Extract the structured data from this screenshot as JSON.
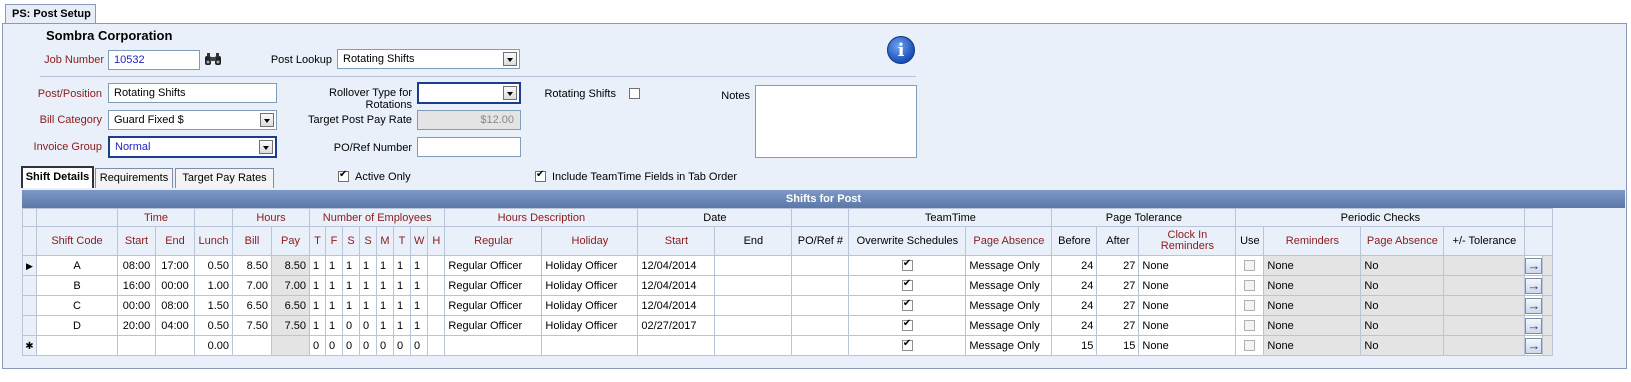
{
  "window": {
    "tab_title": "PS: Post Setup"
  },
  "header": {
    "company": "Sombra Corporation"
  },
  "form": {
    "job_number_label": "Job Number",
    "job_number": "10532",
    "post_lookup_label": "Post Lookup",
    "post_lookup": "Rotating Shifts",
    "post_position_label": "Post/Position",
    "post_position": "Rotating Shifts",
    "bill_category_label": "Bill Category",
    "bill_category": "Guard Fixed $",
    "invoice_group_label": "Invoice Group",
    "invoice_group": "Normal",
    "rollover_label": "Rollover Type for Rotations",
    "rollover": "",
    "target_rate_label": "Target Post Pay Rate",
    "target_rate": "$12.00",
    "po_ref_label": "PO/Ref Number",
    "po_ref": "",
    "rotating_label": "Rotating Shifts",
    "rotating_checked": false,
    "notes_label": "Notes",
    "active_only_label": "Active Only",
    "active_only_checked": true,
    "include_tt_label": "Include TeamTime Fields in Tab Order",
    "include_tt_checked": true
  },
  "tabs": [
    "Shift Details",
    "Requirements",
    "Target Pay Rates"
  ],
  "icons": {
    "info": "info-icon",
    "lookup": "binoculars-icon",
    "row_pointer": "row-pointer-icon",
    "new_row": "new-row-icon",
    "detail": "arrow-right-icon"
  },
  "grid": {
    "title": "Shifts for Post",
    "groups": {
      "time": "Time",
      "hours": "Hours",
      "employees": "Number of Employees",
      "hours_desc": "Hours Description",
      "date": "Date",
      "teamtime": "TeamTime",
      "page_tol": "Page Tolerance",
      "periodic": "Periodic Checks"
    },
    "columns": {
      "shift_code": "Shift Code",
      "start": "Start",
      "end": "End",
      "lunch": "Lunch",
      "bill": "Bill",
      "pay": "Pay",
      "t": "T",
      "f": "F",
      "s": "S",
      "s2": "S",
      "m": "M",
      "t2": "T",
      "w": "W",
      "h": "H",
      "regular": "Regular",
      "holiday": "Holiday",
      "date_start": "Start",
      "date_end": "End",
      "po_ref": "PO/Ref #",
      "overwrite": "Overwrite Schedules",
      "page_absence": "Page Absence",
      "before": "Before",
      "after": "After",
      "clock_in": "Clock In Reminders",
      "use": "Use",
      "reminders": "Reminders",
      "pc_page_absence": "Page Absence",
      "tolerance": "+/- Tolerance"
    },
    "rows": [
      {
        "code": "A",
        "start": "08:00",
        "end": "17:00",
        "lunch": "0.50",
        "bill": "8.50",
        "pay": "8.50",
        "e": [
          "1",
          "1",
          "1",
          "1",
          "1",
          "1",
          "1",
          ""
        ],
        "regular": "Regular Officer",
        "holiday": "Holiday Officer",
        "dstart": "12/04/2014",
        "dend": "",
        "po": "",
        "overwrite": true,
        "tt_absence": "Message Only",
        "before": "24",
        "after": "27",
        "clock": "None",
        "use": false,
        "reminders": "None",
        "pc_absence": "No",
        "tolerance": ""
      },
      {
        "code": "B",
        "start": "16:00",
        "end": "00:00",
        "lunch": "1.00",
        "bill": "7.00",
        "pay": "7.00",
        "e": [
          "1",
          "1",
          "1",
          "1",
          "1",
          "1",
          "1",
          ""
        ],
        "regular": "Regular Officer",
        "holiday": "Holiday Officer",
        "dstart": "12/04/2014",
        "dend": "",
        "po": "",
        "overwrite": true,
        "tt_absence": "Message Only",
        "before": "24",
        "after": "27",
        "clock": "None",
        "use": false,
        "reminders": "None",
        "pc_absence": "No",
        "tolerance": ""
      },
      {
        "code": "C",
        "start": "00:00",
        "end": "08:00",
        "lunch": "1.50",
        "bill": "6.50",
        "pay": "6.50",
        "e": [
          "1",
          "1",
          "1",
          "1",
          "1",
          "1",
          "1",
          ""
        ],
        "regular": "Regular Officer",
        "holiday": "Holiday Officer",
        "dstart": "12/04/2014",
        "dend": "",
        "po": "",
        "overwrite": true,
        "tt_absence": "Message Only",
        "before": "24",
        "after": "27",
        "clock": "None",
        "use": false,
        "reminders": "None",
        "pc_absence": "No",
        "tolerance": ""
      },
      {
        "code": "D",
        "start": "20:00",
        "end": "04:00",
        "lunch": "0.50",
        "bill": "7.50",
        "pay": "7.50",
        "e": [
          "1",
          "1",
          "0",
          "0",
          "1",
          "1",
          "1",
          ""
        ],
        "regular": "Regular Officer",
        "holiday": "Holiday Officer",
        "dstart": "02/27/2017",
        "dend": "",
        "po": "",
        "overwrite": true,
        "tt_absence": "Message Only",
        "before": "24",
        "after": "27",
        "clock": "None",
        "use": false,
        "reminders": "None",
        "pc_absence": "No",
        "tolerance": ""
      }
    ],
    "new_row": {
      "code": "",
      "start": "",
      "end": "",
      "lunch": "0.00",
      "bill": "",
      "pay": "",
      "e": [
        "0",
        "0",
        "0",
        "0",
        "0",
        "0",
        "0",
        ""
      ],
      "regular": "",
      "holiday": "",
      "dstart": "",
      "dend": "",
      "po": "",
      "overwrite": true,
      "tt_absence": "Message Only",
      "before": "15",
      "after": "15",
      "clock": "None",
      "use": false,
      "reminders": "None",
      "pc_absence": "No",
      "tolerance": ""
    }
  }
}
